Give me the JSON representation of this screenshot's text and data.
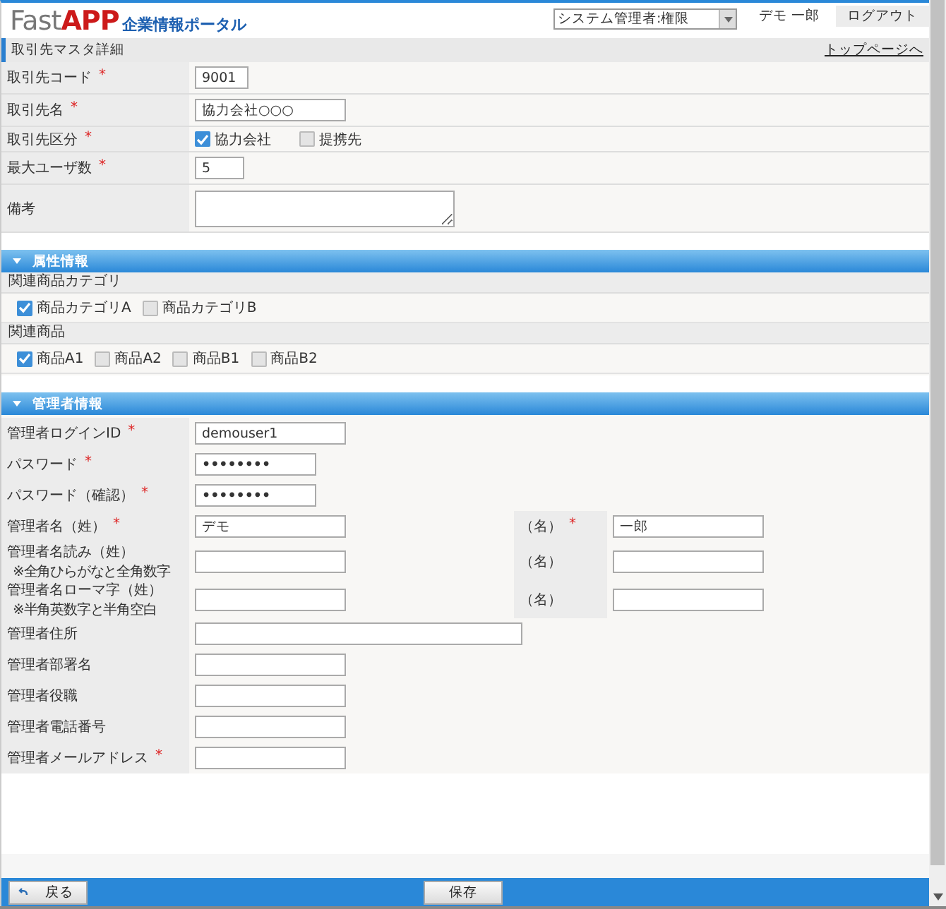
{
  "header": {
    "logo": {
      "main": "Fast",
      "accent": "APP",
      "subtitle": "企業情報ポータル"
    },
    "role_select": "システム管理者:権限",
    "tabs": [
      {
        "label": "デモ 一郎",
        "selected": true
      },
      {
        "label": "ログアウト",
        "selected": false
      }
    ]
  },
  "page_title": "取引先マスタ詳細",
  "top_link": "トップページへ",
  "basic_fields": [
    {
      "label": "取引先コード",
      "mark": "*",
      "kind": "text",
      "value": "9001"
    },
    {
      "label": "取引先名",
      "mark": "*",
      "kind": "text",
      "value": "協力会社○○○"
    },
    {
      "label": "取引先区分",
      "mark": "*",
      "kind": "checkboxes",
      "options": [
        {
          "label": "協力会社",
          "checked": true
        },
        {
          "label": "提携先",
          "checked": false
        }
      ]
    },
    {
      "label": "最大ユーザ数",
      "mark": "*",
      "kind": "text",
      "value": "5"
    },
    {
      "label": "備考",
      "kind": "textarea"
    }
  ],
  "attribute_section": {
    "title": "属性情報",
    "expanded": true,
    "groups": [
      {
        "title": "関連商品カテゴリ",
        "options": [
          {
            "label": "商品カテゴリA",
            "checked": true
          },
          {
            "label": "商品カテゴリB",
            "checked": false
          }
        ]
      },
      {
        "title": "関連商品",
        "options": [
          {
            "label": "商品A1",
            "checked": true
          },
          {
            "label": "商品A2",
            "checked": false
          },
          {
            "label": "商品B1",
            "checked": false
          },
          {
            "label": "商品B2",
            "checked": false
          }
        ]
      }
    ]
  },
  "admin_section": {
    "title": "管理者情報",
    "expanded": true,
    "rows": [
      {
        "label": "管理者ログインID",
        "mark": "*",
        "value": "demouser1"
      },
      {
        "label": "パスワード",
        "mark": "*",
        "kind": "password",
        "value": "••••••••"
      },
      {
        "label": "パスワード（確認）",
        "mark": "*",
        "kind": "password",
        "value": "••••••••"
      },
      {
        "label": "管理者名（姓）",
        "mark": "*",
        "value": "デモ",
        "second": {
          "label": "（名）",
          "mark": "*",
          "value": "一郎"
        }
      },
      {
        "label": "管理者名読み（姓）",
        "note": "※全角ひらがなと全角数字",
        "second": {
          "label": "（名）"
        }
      },
      {
        "label": "管理者名ローマ字（姓）",
        "note": "※半角英数字と半角空白",
        "second": {
          "label": "（名）"
        }
      },
      {
        "label": "管理者住所",
        "kind": "wide"
      },
      {
        "label": "管理者部署名"
      },
      {
        "label": "管理者役職"
      },
      {
        "label": "管理者電話番号"
      },
      {
        "label": "管理者メールアドレス",
        "mark": "*"
      }
    ]
  },
  "footer": {
    "back_button": "戻る",
    "save_button": "保存"
  }
}
